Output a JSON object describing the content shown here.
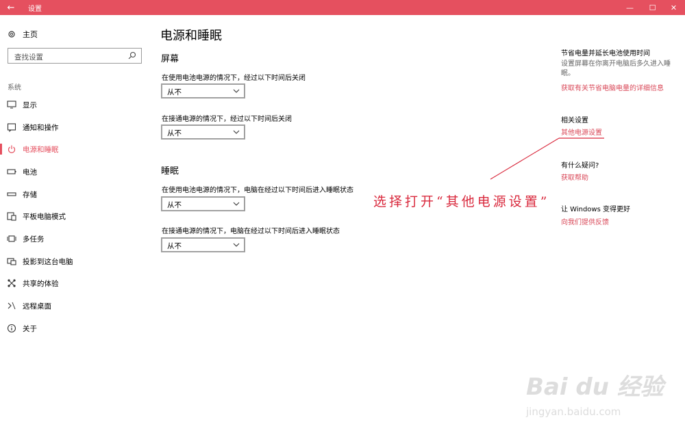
{
  "titlebar": {
    "title": "设置",
    "back": "←",
    "minimize": "—",
    "maximize": "☐",
    "close": "✕"
  },
  "sidebar": {
    "home": "主页",
    "search_placeholder": "查找设置",
    "section": "系统",
    "items": [
      {
        "label": "显示",
        "icon": "monitor-icon"
      },
      {
        "label": "通知和操作",
        "icon": "notification-icon"
      },
      {
        "label": "电源和睡眠",
        "icon": "power-icon",
        "active": true
      },
      {
        "label": "电池",
        "icon": "battery-icon"
      },
      {
        "label": "存储",
        "icon": "storage-icon"
      },
      {
        "label": "平板电脑模式",
        "icon": "tablet-icon"
      },
      {
        "label": "多任务",
        "icon": "multitask-icon"
      },
      {
        "label": "投影到这台电脑",
        "icon": "project-icon"
      },
      {
        "label": "共享的体验",
        "icon": "share-icon"
      },
      {
        "label": "远程桌面",
        "icon": "remote-icon"
      },
      {
        "label": "关于",
        "icon": "info-icon"
      }
    ]
  },
  "main": {
    "title": "电源和睡眠",
    "screen": {
      "heading": "屏幕",
      "battery_desc": "在使用电池电源的情况下，经过以下时间后关闭",
      "battery_value": "从不",
      "plugged_desc": "在接通电源的情况下，经过以下时间后关闭",
      "plugged_value": "从不"
    },
    "sleep": {
      "heading": "睡眠",
      "battery_desc": "在使用电池电源的情况下，电脑在经过以下时间后进入睡眠状态",
      "battery_value": "从不",
      "plugged_desc": "在接通电源的情况下，电脑在经过以下时间后进入睡眠状态",
      "plugged_value": "从不"
    }
  },
  "right": {
    "battery_heading": "节省电量并延长电池使用时间",
    "battery_desc": "设置屏幕在你离开电脑后多久进入睡眠。",
    "battery_link": "获取有关节省电脑电量的详细信息",
    "related_heading": "相关设置",
    "related_link": "其他电源设置",
    "question_heading": "有什么疑问?",
    "question_link": "获取帮助",
    "feedback_heading": "让 Windows 变得更好",
    "feedback_link": "向我们提供反馈"
  },
  "annotation": "选择打开“其他电源设置”",
  "watermark": {
    "brand": "Bai du 经验",
    "url": "jingyan.baidu.com"
  },
  "colors": {
    "accent": "#e5505f",
    "link": "#d94858",
    "annotation": "#d9283c"
  }
}
